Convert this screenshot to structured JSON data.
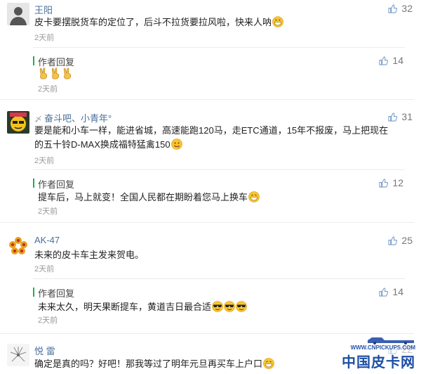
{
  "comments": [
    {
      "username": "王阳",
      "text": "皮卡要摆脱货车的定位了，后斗不拉货要拉风啦，快来人呐",
      "time": "2天前",
      "likes": "32",
      "reply": {
        "label": "作者回复",
        "text": "",
        "time": "2天前",
        "likes": "14"
      }
    },
    {
      "username": "奋斗吧、小青年°",
      "text_line1": "要是能和小车一样，能进省城，高速能跑120马，走ETC通道，15年不报废，马上把现在",
      "text_line2": "的五十铃D-MAX换成福特猛禽150",
      "time": "2天前",
      "likes": "31",
      "reply": {
        "label": "作者回复",
        "text": "提车后，马上就变！全国人民都在期盼着您马上换车",
        "time": "2天前",
        "likes": "12"
      }
    },
    {
      "username": "AK-47",
      "text": "未来的皮卡车主发来贺电。",
      "time": "2天前",
      "likes": "25",
      "reply": {
        "label": "作者回复",
        "text": "未来太久，明天果断提车，黄道吉日最合适",
        "time": "2天前",
        "likes": "14"
      }
    },
    {
      "username": "悦 雷",
      "text": "确定是真的吗？好吧！那我等过了明年元旦再买车上户口",
      "likes": "22"
    }
  ],
  "watermark": {
    "url": "WWW.CNPICKUPS.COM",
    "text": "中国皮卡网"
  },
  "colors": {
    "username": "#4a6f9a",
    "reply_bar": "#19b34a",
    "watermark": "#1d4fa6"
  }
}
